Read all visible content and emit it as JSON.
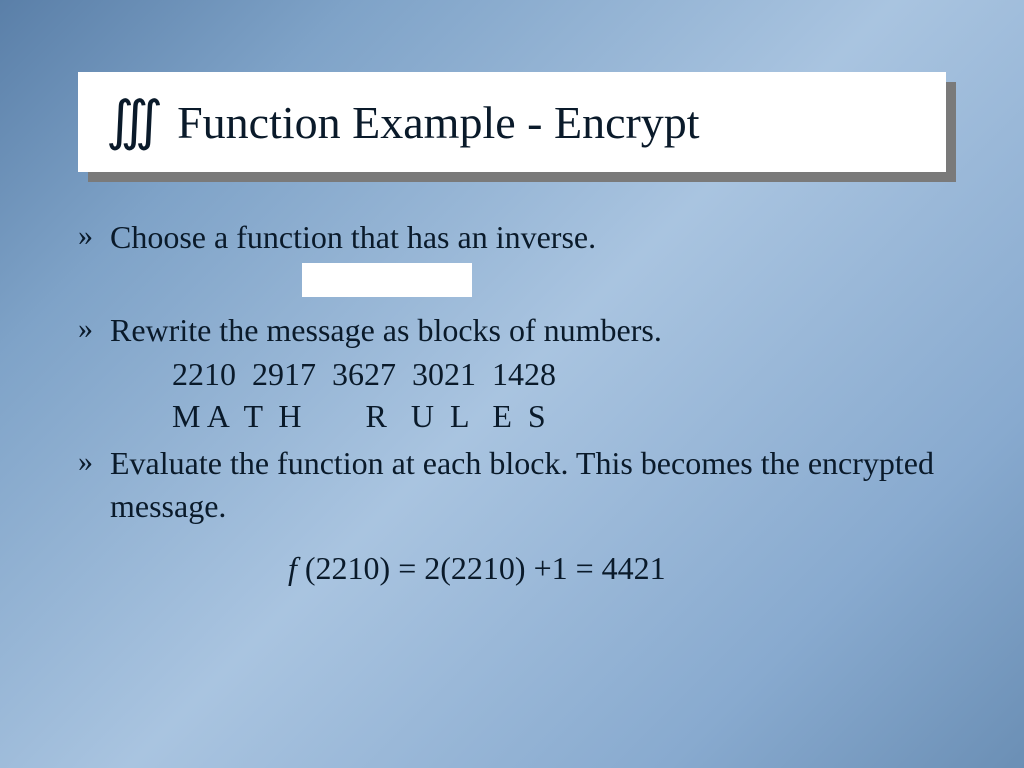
{
  "title": {
    "icon": "∭",
    "text": "Function Example - Encrypt"
  },
  "bullets": {
    "mark": "»",
    "b1": "Choose a function that has an inverse.",
    "b2": "Rewrite the message as blocks of numbers.",
    "b2_sub1": "2210  2917  3627  3021  1428",
    "b2_sub2": "M A  T  H        R   U  L   E  S",
    "b3": "Evaluate the function at each block. This becomes the encrypted message."
  },
  "formula": {
    "f": "f",
    "p1": " (2210) ",
    "eq1": "=",
    "p2": " 2(2210) ",
    "plus": "+",
    "one": "1 ",
    "eq2": "=",
    "res": " 4421"
  }
}
